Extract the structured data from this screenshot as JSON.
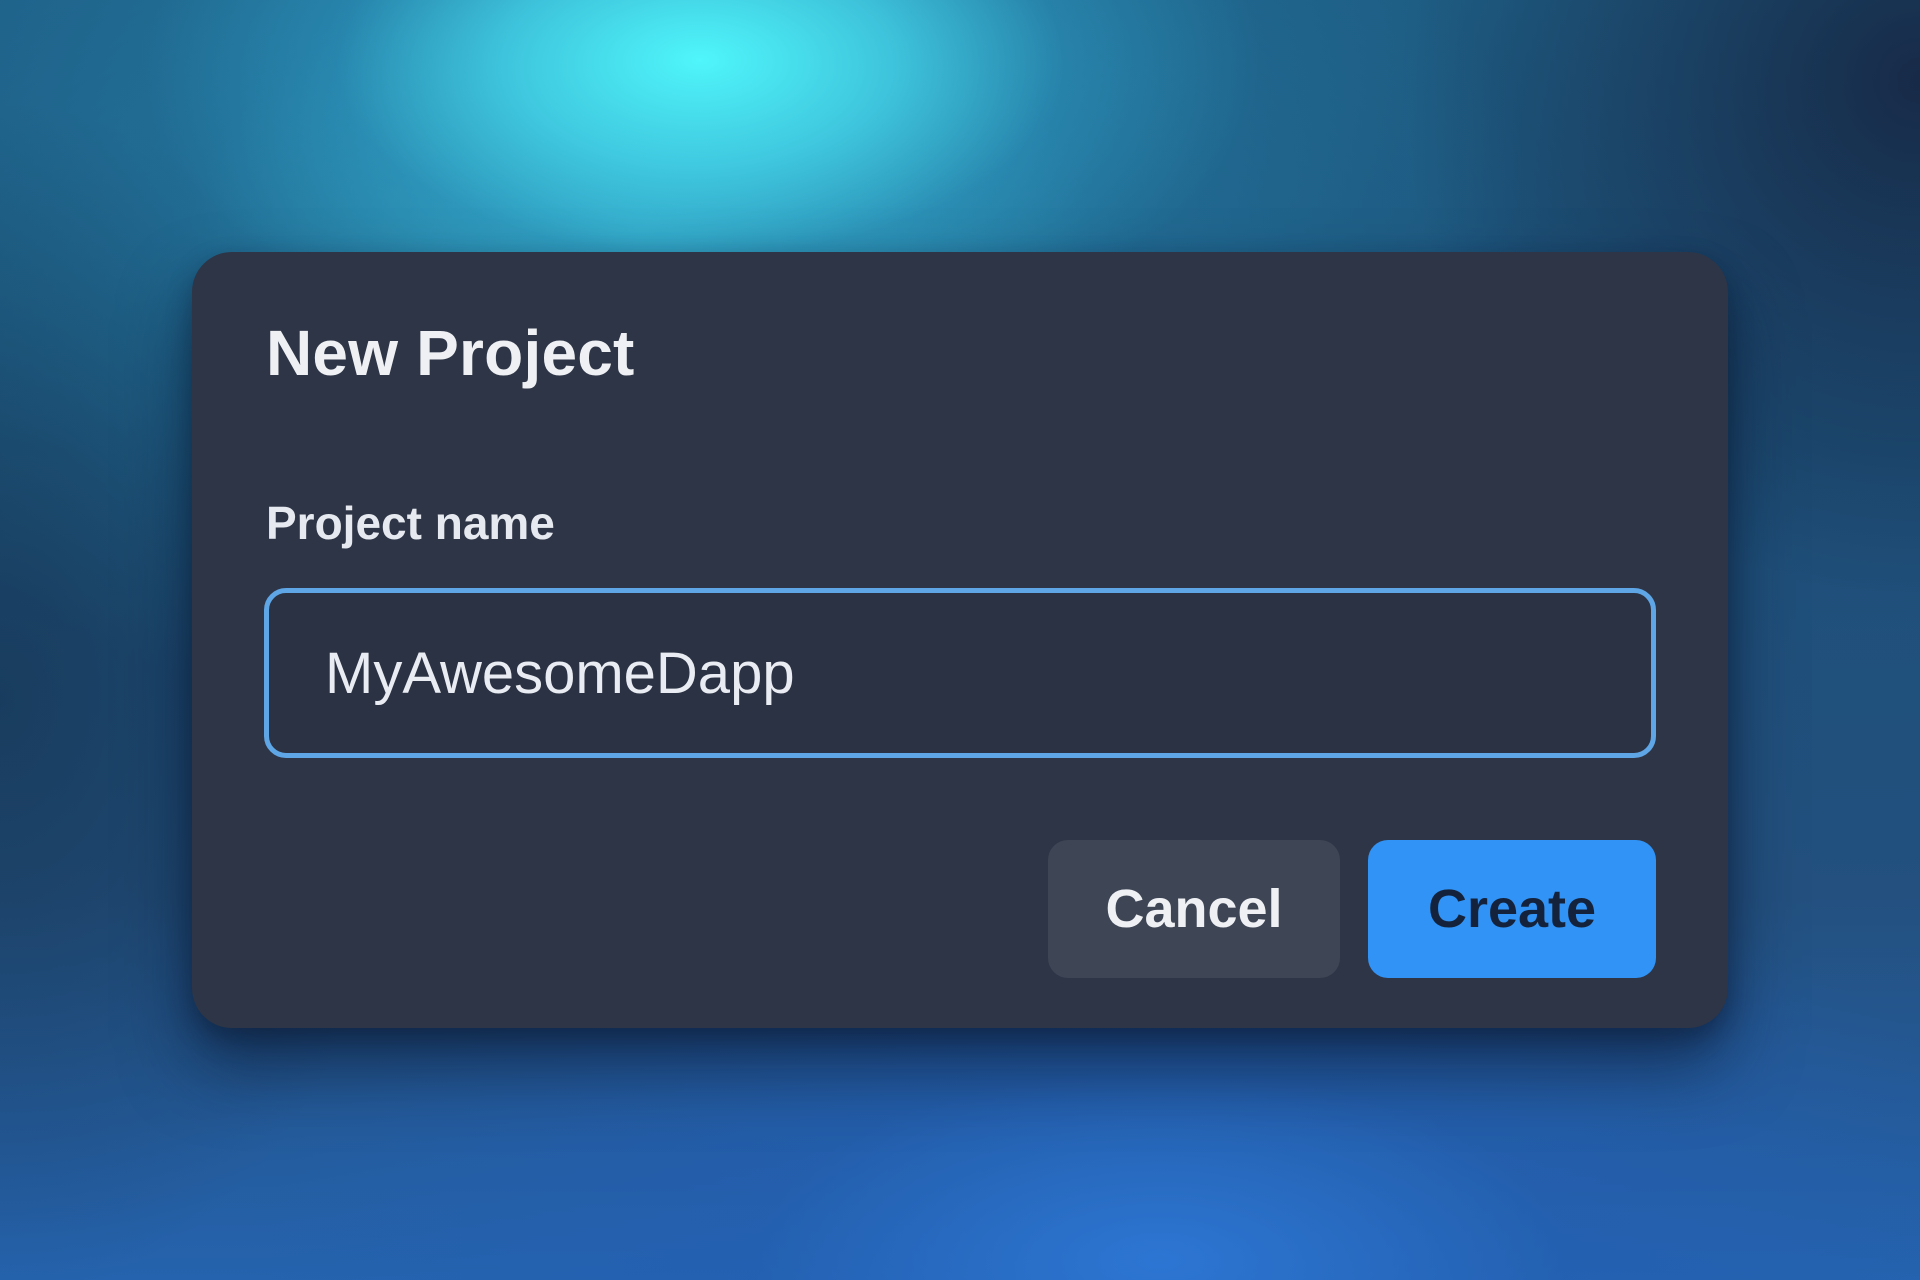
{
  "dialog": {
    "title": "New Project",
    "field_label": "Project name",
    "input_value": "MyAwesomeDapp",
    "cancel_label": "Cancel",
    "create_label": "Create"
  },
  "colors": {
    "dialog_background": "#2e3546",
    "input_focus_border": "#5fa6e6",
    "primary_button": "#3193f5",
    "secondary_button": "#3e4555"
  }
}
